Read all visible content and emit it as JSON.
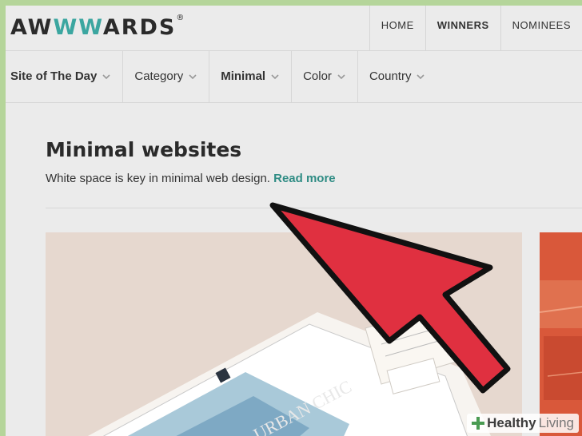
{
  "logo": {
    "text_pre": "AW",
    "text_ww": "WW",
    "text_post": "ARDS",
    "reg": "®"
  },
  "nav": {
    "items": [
      "HOME",
      "WINNERS",
      "NOMINEES"
    ]
  },
  "filters": {
    "items": [
      "Site of The Day",
      "Category",
      "Minimal",
      "Color",
      "Country"
    ]
  },
  "main": {
    "title": "Minimal websites",
    "description": "White space is key in minimal web design.",
    "read_more": "Read more"
  },
  "mockup": {
    "brand_text": "URBAN CHIC"
  },
  "watermark": {
    "brand": "Healthy",
    "brand2": "Living"
  },
  "colors": {
    "accent": "#3ba6a0",
    "arrow": "#e03040",
    "card_bg": "#e6d8cf",
    "card2_bg": "#d9583a"
  },
  "icons": [
    "chevron-down-icon",
    "arrow-pointer",
    "plus-icon"
  ]
}
